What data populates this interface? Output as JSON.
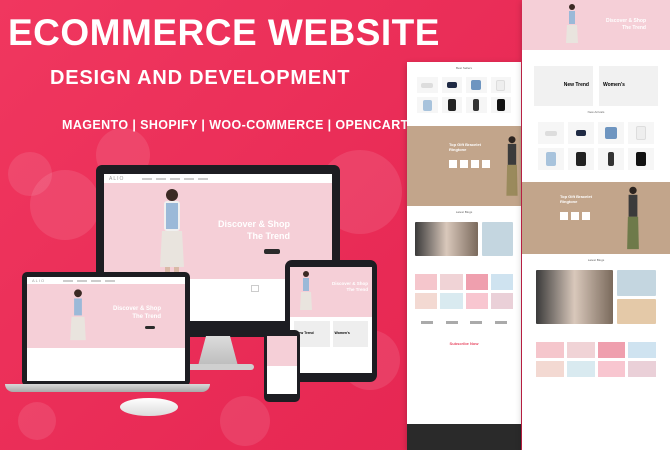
{
  "headline": "ECOMMERCE WEBSITE",
  "subhead": "DESIGN AND DEVELOPMENT",
  "platforms": "MAGENTO | SHOPIFY | WOO-COMMERCE | OPENCART",
  "mockup": {
    "logo": "ALIO",
    "hero_line1": "Discover & Shop",
    "hero_line2": "The Trend",
    "section_new": "New Trend",
    "section_women": "Women's",
    "section_deal": "Top Gift Bracelet Ringtone",
    "section_subscribe": "Subscribe Now"
  },
  "colors": {
    "background": "#ea2f59",
    "hero_pink": "#f5cfd7",
    "tan_banner": "#c2a58b",
    "device_frame": "#1d1d22"
  }
}
